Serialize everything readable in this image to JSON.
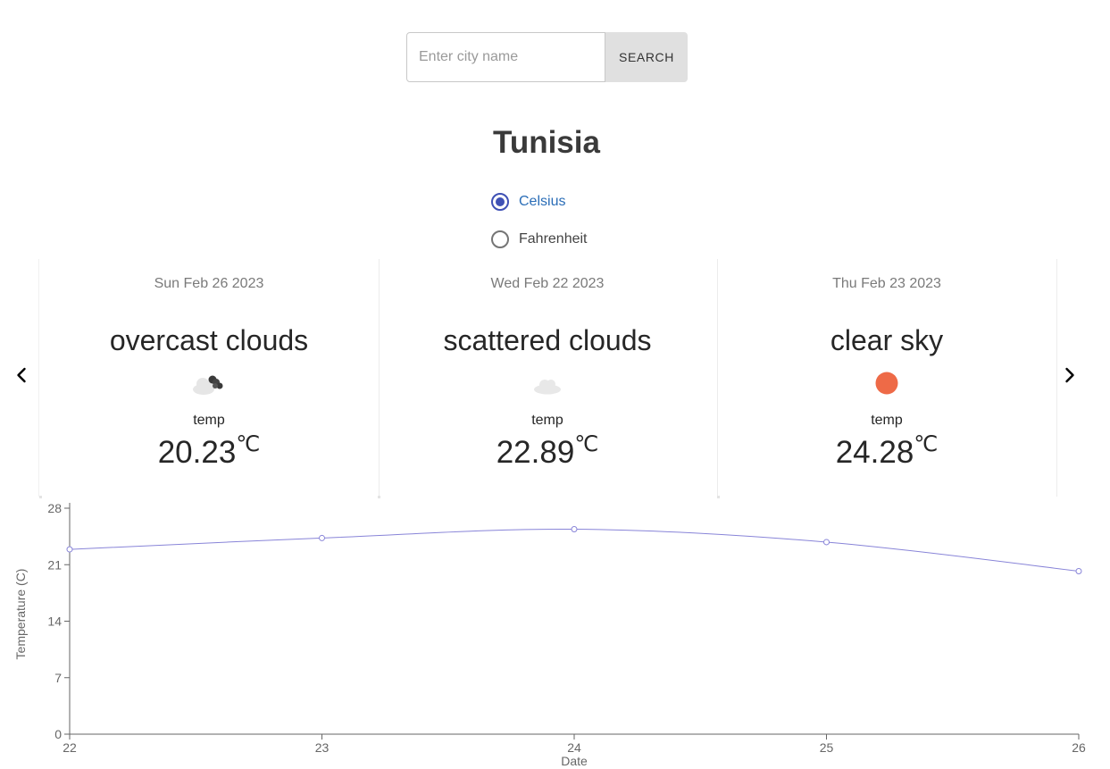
{
  "search": {
    "placeholder": "Enter city name",
    "value": "",
    "button_label": "SEARCH"
  },
  "city": "Tunisia",
  "units": {
    "selected": "Celsius",
    "options": [
      "Celsius",
      "Fahrenheit"
    ]
  },
  "accent_color": "#3f51b5",
  "forecast": [
    {
      "date": "Sun Feb 26 2023",
      "description": "overcast clouds",
      "icon": "overcast-clouds-icon",
      "temp_label": "temp",
      "temp": "20.23",
      "unit": "℃"
    },
    {
      "date": "Wed Feb 22 2023",
      "description": "scattered clouds",
      "icon": "scattered-clouds-icon",
      "temp_label": "temp",
      "temp": "22.89",
      "unit": "℃"
    },
    {
      "date": "Thu Feb 23 2023",
      "description": "clear sky",
      "icon": "sun-icon",
      "temp_label": "temp",
      "temp": "24.28",
      "unit": "℃"
    }
  ],
  "chart_data": {
    "type": "line",
    "x": [
      22,
      23,
      24,
      25,
      26
    ],
    "series": [
      {
        "values": [
          22.9,
          24.3,
          25.4,
          23.8,
          20.2
        ],
        "color": "#8884d8"
      }
    ],
    "xlabel": "Date",
    "ylabel": "Temperature (C)",
    "xlim": [
      22,
      26
    ],
    "ylim": [
      0,
      28
    ],
    "yticks": [
      0,
      7,
      14,
      21,
      28
    ],
    "xticks": [
      22,
      23,
      24,
      25,
      26
    ],
    "grid": false,
    "legend": "none"
  }
}
